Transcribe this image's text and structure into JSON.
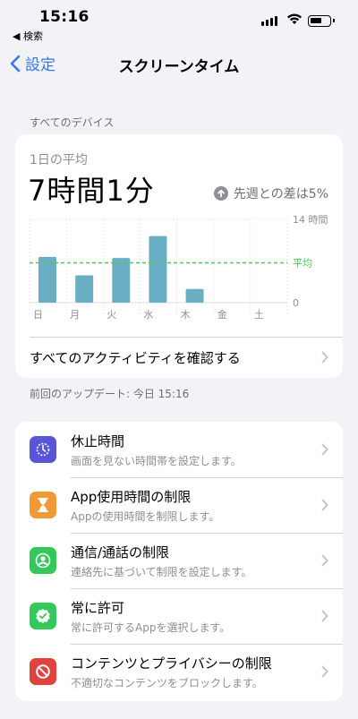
{
  "status_bar": {
    "time": "15:16",
    "back_app": "◀ 検索"
  },
  "nav": {
    "back_label": "設定",
    "title": "スクリーンタイム"
  },
  "section": {
    "devices_label": "すべてのデバイス"
  },
  "summary": {
    "daily_average_label": "1日の平均",
    "daily_average_value": "7時間1分",
    "comparison": "先週との差は5%",
    "see_all_activity": "すべてのアクティビティを確認する"
  },
  "chart_data": {
    "type": "bar",
    "categories": [
      "日",
      "月",
      "火",
      "水",
      "木",
      "金",
      "土"
    ],
    "values": [
      7.7,
      4.6,
      7.5,
      11.2,
      2.3,
      0,
      0
    ],
    "average": 6.7,
    "average_label": "平均",
    "ylim": [
      0,
      14
    ],
    "y_ticks": [
      "14 時間",
      "0"
    ],
    "grid": true,
    "bar_color": "#6aaec4",
    "average_color": "#5cc05c"
  },
  "last_updated": "前回のアップデート: 今日 15:16",
  "items": [
    {
      "title": "休止時間",
      "subtitle": "画面を見ない時間帯を設定します。",
      "icon": "downtime-icon",
      "color": "#5856d6"
    },
    {
      "title": "App使用時間の制限",
      "subtitle": "Appの使用時間を制限します。",
      "icon": "hourglass-icon",
      "color": "#f09a37"
    },
    {
      "title": "通信/通話の制限",
      "subtitle": "連絡先に基づいて制限を設定します。",
      "icon": "contact-icon",
      "color": "#34c759"
    },
    {
      "title": "常に許可",
      "subtitle": "常に許可するAppを選択します。",
      "icon": "checkmark-badge-icon",
      "color": "#34c759"
    },
    {
      "title": "コンテンツとプライバシーの制限",
      "subtitle": "不適切なコンテンツをブロックします。",
      "icon": "no-entry-icon",
      "color": "#e0433b"
    }
  ]
}
